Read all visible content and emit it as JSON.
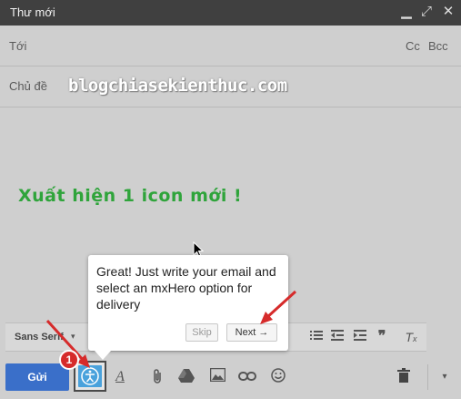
{
  "window": {
    "title": "Thư mới",
    "controls": {
      "minimize": "▁",
      "expand": "⤢",
      "close": "✕"
    }
  },
  "fields": {
    "to_label": "Tới",
    "cc_label": "Cc",
    "bcc_label": "Bcc",
    "subject_label": "Chủ đề"
  },
  "watermark": "blogchiasekienthuc.com",
  "body_note": "Xuất hiện 1 icon mới !",
  "format_toolbar": {
    "font": "Sans Serif"
  },
  "bottom_toolbar": {
    "send_label": "Gửi",
    "icons": [
      "mxhero-icon",
      "text-format-icon",
      "attach-icon",
      "drive-icon",
      "photo-icon",
      "link-icon",
      "emoji-icon",
      "trash-icon",
      "more-options-icon"
    ]
  },
  "popup": {
    "message": "Great! Just write your email and select an mxHero option for delivery",
    "skip_label": "Skip",
    "next_label": "Next →"
  },
  "annotation": {
    "badge_number": "1",
    "color": "#d62b2b"
  },
  "colors": {
    "titlebar": "#404040",
    "send_button": "#3a6fc9",
    "mxhero_button": "#4aa2dc",
    "note_green": "#2fa43b"
  }
}
